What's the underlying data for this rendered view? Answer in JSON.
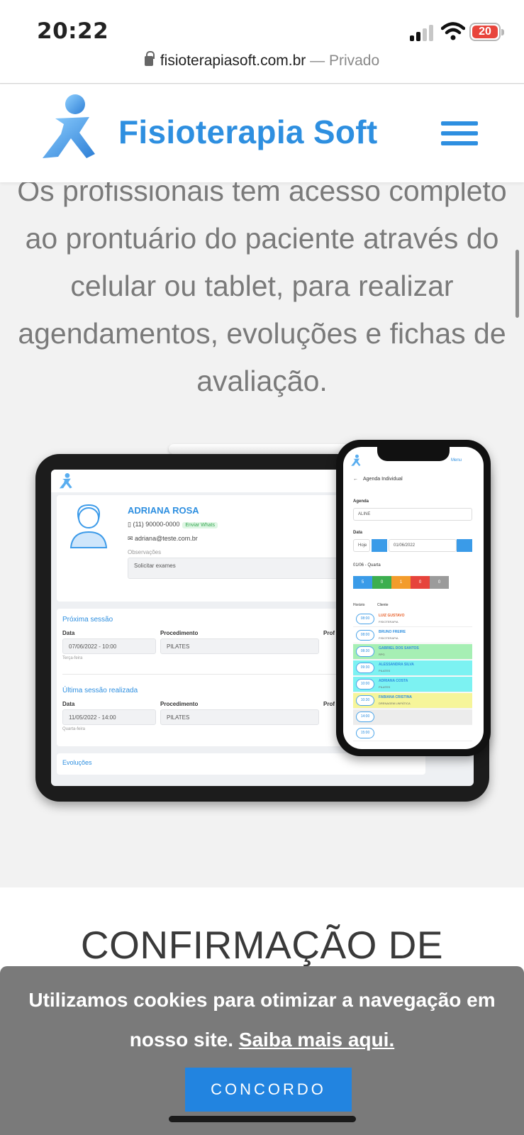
{
  "status_bar": {
    "time": "20:22",
    "battery": "20"
  },
  "browser": {
    "domain": "fisioterapiasoft.com.br",
    "privacy": "— Privado"
  },
  "header": {
    "brand": "Fisioterapia Soft",
    "brand_color": "#2e8fe0"
  },
  "intro_text": "Os profissionais tem acesso completo ao prontuário do paciente através do celular ou tablet, para realizar agendamentos, evoluções e fichas de avaliação.",
  "tablet_mock": {
    "patient_name": "ADRIANA ROSA",
    "phone": "(11) 90000-0000",
    "whatsapp": "Enviar Whats",
    "email": "adriana@teste.com.br",
    "obs_label": "Observações",
    "obs_value": "Solicitar exames",
    "next_session": "Próxima sessão",
    "last_session": "Última sessão realizada",
    "col_date": "Data",
    "col_proc": "Procedimento",
    "col_prof": "Prof",
    "next_date": "07/06/2022 - 10:00",
    "next_day": "Terça-feira",
    "next_proc": "PILATES",
    "last_date": "11/05/2022 - 14:00",
    "last_day": "Quarta-feira",
    "last_proc": "PILATES",
    "evolutions": "Evoluções"
  },
  "phone_mock": {
    "menu": "Menu",
    "title": "Agenda Individual",
    "agenda_label": "Agenda",
    "agenda_value": "ALINE",
    "date_label": "Data",
    "today": "Hoje",
    "date_value": "01/06/2022",
    "day": "01/06 - Quarta",
    "badges": [
      "5",
      "0",
      "1",
      "0",
      "0"
    ],
    "col_time": "Horário",
    "col_client": "Cliente",
    "rows": [
      {
        "time": "08:00",
        "name": "LUIZ GUSTAVO",
        "sub": "FISIOTERAPIA",
        "bg": "#ffffff",
        "color": "#e8622c"
      },
      {
        "time": "08:00",
        "name": "BRUNO FREIRE",
        "sub": "FISIOTERAPIA",
        "bg": "#ffffff",
        "color": "#2e8fe0"
      },
      {
        "time": "08:30",
        "name": "GABRIEL DOS SANTOS",
        "sub": "RPG",
        "bg": "#a6efb4",
        "color": "#2e8fe0"
      },
      {
        "time": "09:30",
        "name": "ALESSANDRA SILVA",
        "sub": "PILATES",
        "bg": "#7cf2f2",
        "color": "#2e8fe0"
      },
      {
        "time": "10:00",
        "name": "ADRIANA COSTA",
        "sub": "PILATES",
        "bg": "#7cf2f2",
        "color": "#2e8fe0"
      },
      {
        "time": "10:30",
        "name": "FABIANA CRISTINA",
        "sub": "DRENAGEM LINFÁTICA",
        "bg": "#f6f59a",
        "color": "#2e8fe0"
      },
      {
        "time": "14:00",
        "name": "",
        "sub": "",
        "bg": "#ececec",
        "color": "#2e8fe0"
      },
      {
        "time": "15:00",
        "name": "",
        "sub": "",
        "bg": "#ffffff",
        "color": "#2e8fe0"
      }
    ]
  },
  "section_title": "CONFIRMAÇÃO DE",
  "cookie": {
    "text": "Utilizamos cookies para otimizar a navegação em nosso site.",
    "link": "Saiba mais aqui.",
    "button": "CONCORDO"
  }
}
